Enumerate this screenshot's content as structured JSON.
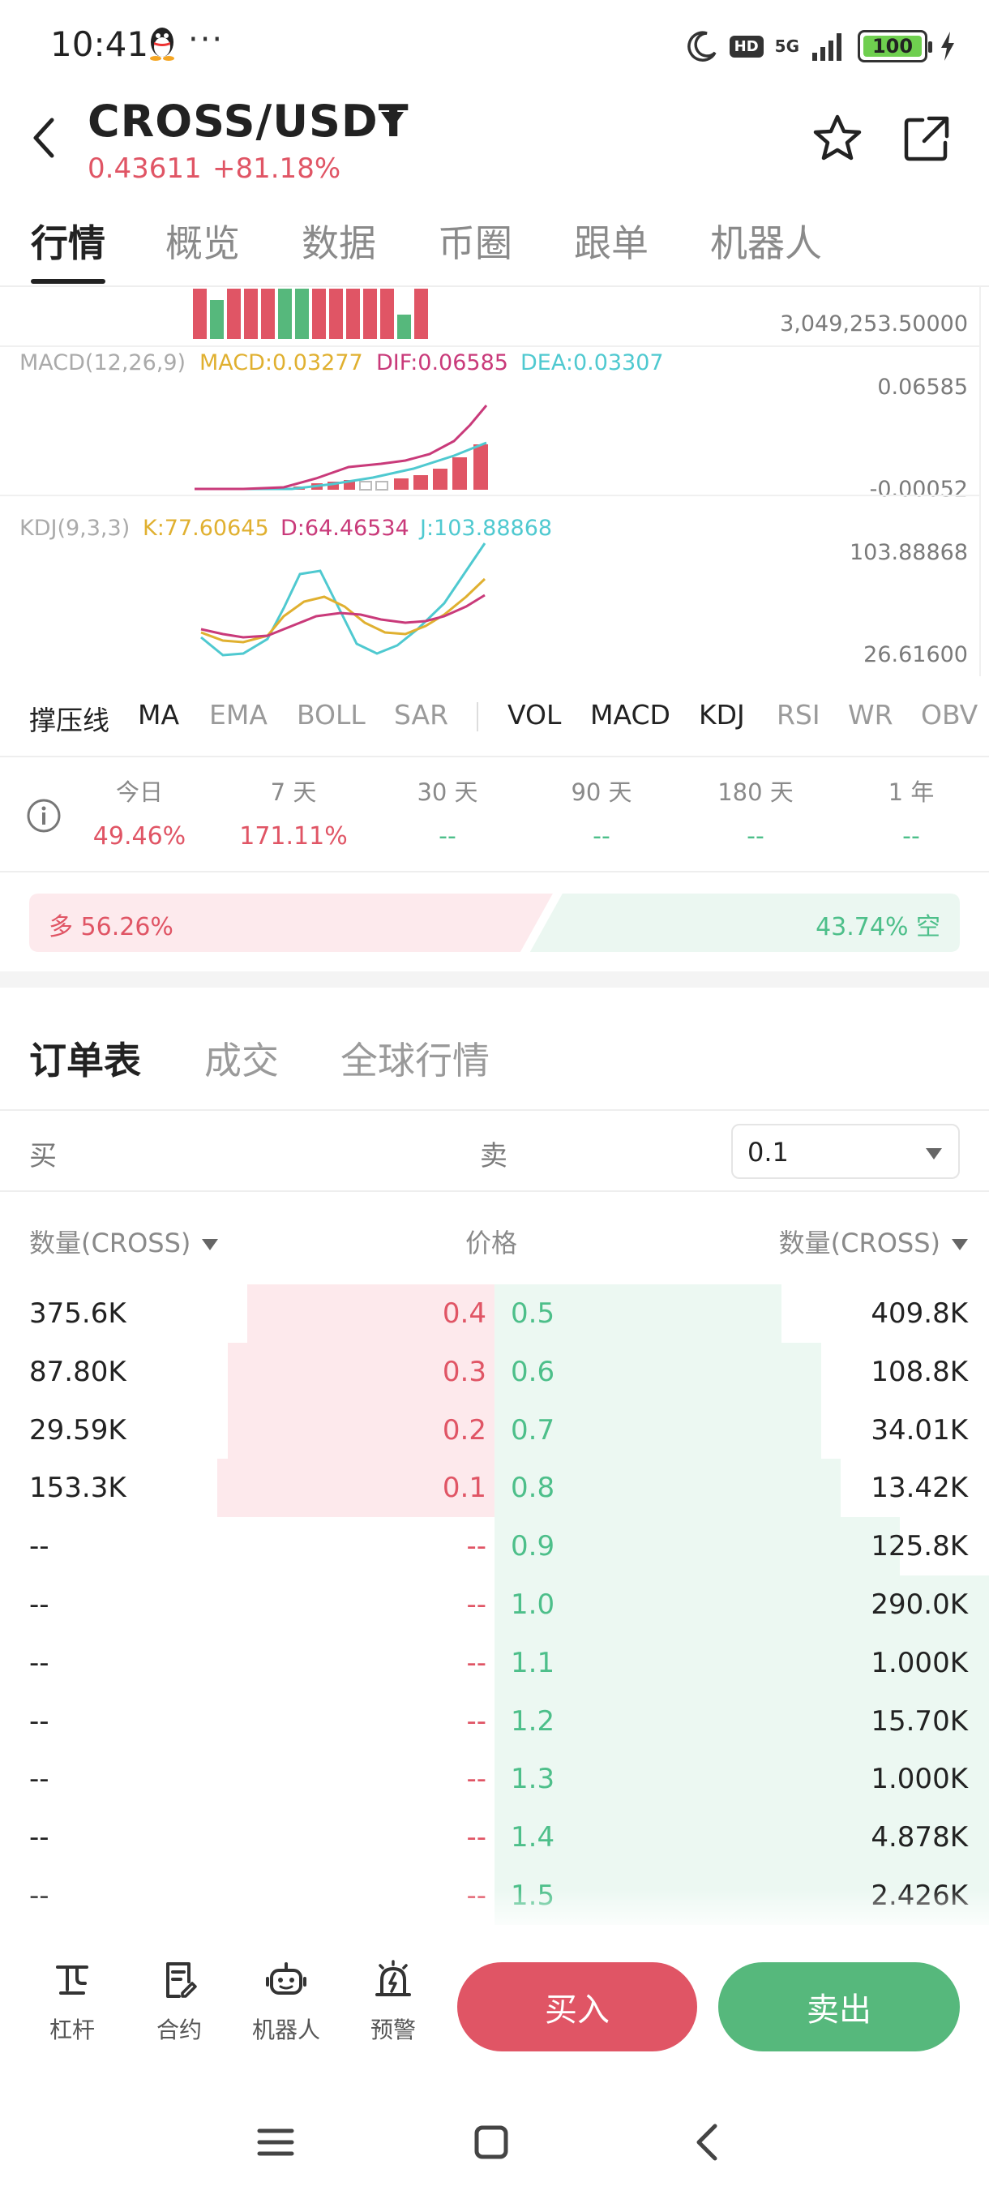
{
  "status_bar": {
    "time": "10:41",
    "dots": "···",
    "network": "5G",
    "hd": "HD",
    "battery": "100"
  },
  "header": {
    "pair": "CROSS/USDT",
    "price": "0.43611",
    "change": "+81.18%"
  },
  "main_tabs": [
    "行情",
    "概览",
    "数据",
    "币圈",
    "跟单",
    "机器人"
  ],
  "charts": {
    "vol_axis": "3,049,253.50000",
    "macd": {
      "name": "MACD(12,26,9)",
      "macd": "MACD:0.03277",
      "dif": "DIF:0.06585",
      "dea": "DEA:0.03307",
      "axis_top": "0.06585",
      "axis_bottom": "-0.00052"
    },
    "kdj": {
      "name": "KDJ(9,3,3)",
      "k": "K:77.60645",
      "d": "D:64.46534",
      "j": "J:103.88868",
      "axis_top": "103.88868",
      "axis_bottom": "26.61600"
    },
    "colors": {
      "up": "#e05565",
      "down": "#56b87c",
      "macd": "#e0b030",
      "dif": "#c93a7a",
      "dea": "#4fc9d0",
      "k": "#e0b030",
      "d": "#c93a7a",
      "j": "#4fc9d0"
    }
  },
  "indicators": [
    "撑压线",
    "MA",
    "EMA",
    "BOLL",
    "SAR",
    "VOL",
    "MACD",
    "KDJ",
    "RSI",
    "WR",
    "OBV"
  ],
  "stats": [
    {
      "label": "今日",
      "value": "49.46%"
    },
    {
      "label": "7 天",
      "value": "171.11%"
    },
    {
      "label": "30 天",
      "value": "--"
    },
    {
      "label": "90 天",
      "value": "--"
    },
    {
      "label": "180 天",
      "value": "--"
    },
    {
      "label": "1 年",
      "value": "--"
    }
  ],
  "long_short": {
    "long_text": "多 56.26%",
    "short_text": "43.74% 空",
    "long_fraction": 0.5626
  },
  "order_tabs": [
    "订单表",
    "成交",
    "全球行情"
  ],
  "book_header": {
    "buy": "买",
    "sell": "卖",
    "depth": "0.1",
    "col_qty_left": "数量(CROSS)",
    "col_price": "价格",
    "col_qty_right": "数量(CROSS)"
  },
  "order_book": [
    {
      "bid_qty": "375.6K",
      "bid_price": "0.4",
      "ask_price": "0.5",
      "ask_qty": "409.8K",
      "bid_depth": 0.25,
      "ask_depth": 0.29
    },
    {
      "bid_qty": "87.80K",
      "bid_price": "0.3",
      "ask_price": "0.6",
      "ask_qty": "108.8K",
      "bid_depth": 0.27,
      "ask_depth": 0.33
    },
    {
      "bid_qty": "29.59K",
      "bid_price": "0.2",
      "ask_price": "0.7",
      "ask_qty": "34.01K",
      "bid_depth": 0.27,
      "ask_depth": 0.33
    },
    {
      "bid_qty": "153.3K",
      "bid_price": "0.1",
      "ask_price": "0.8",
      "ask_qty": "13.42K",
      "bid_depth": 0.28,
      "ask_depth": 0.35
    },
    {
      "bid_qty": "--",
      "bid_price": "--",
      "ask_price": "0.9",
      "ask_qty": "125.8K",
      "bid_depth": 0,
      "ask_depth": 0.41
    },
    {
      "bid_qty": "--",
      "bid_price": "--",
      "ask_price": "1.0",
      "ask_qty": "290.0K",
      "bid_depth": 0,
      "ask_depth": 0.55
    },
    {
      "bid_qty": "--",
      "bid_price": "--",
      "ask_price": "1.1",
      "ask_qty": "1.000K",
      "bid_depth": 0,
      "ask_depth": 0.55
    },
    {
      "bid_qty": "--",
      "bid_price": "--",
      "ask_price": "1.2",
      "ask_qty": "15.70K",
      "bid_depth": 0,
      "ask_depth": 0.55
    },
    {
      "bid_qty": "--",
      "bid_price": "--",
      "ask_price": "1.3",
      "ask_qty": "1.000K",
      "bid_depth": 0,
      "ask_depth": 0.55
    },
    {
      "bid_qty": "--",
      "bid_price": "--",
      "ask_price": "1.4",
      "ask_qty": "4.878K",
      "bid_depth": 0,
      "ask_depth": 0.55
    },
    {
      "bid_qty": "--",
      "bid_price": "--",
      "ask_price": "1.5",
      "ask_qty": "2.426K",
      "bid_depth": 0,
      "ask_depth": 0.55
    }
  ],
  "toolbar": {
    "items": [
      {
        "label": "杠杆",
        "icon": "leverage-icon"
      },
      {
        "label": "合约",
        "icon": "contract-icon"
      },
      {
        "label": "机器人",
        "icon": "robot-icon"
      },
      {
        "label": "预警",
        "icon": "alert-icon"
      }
    ],
    "buy_label": "买入",
    "sell_label": "卖出"
  }
}
